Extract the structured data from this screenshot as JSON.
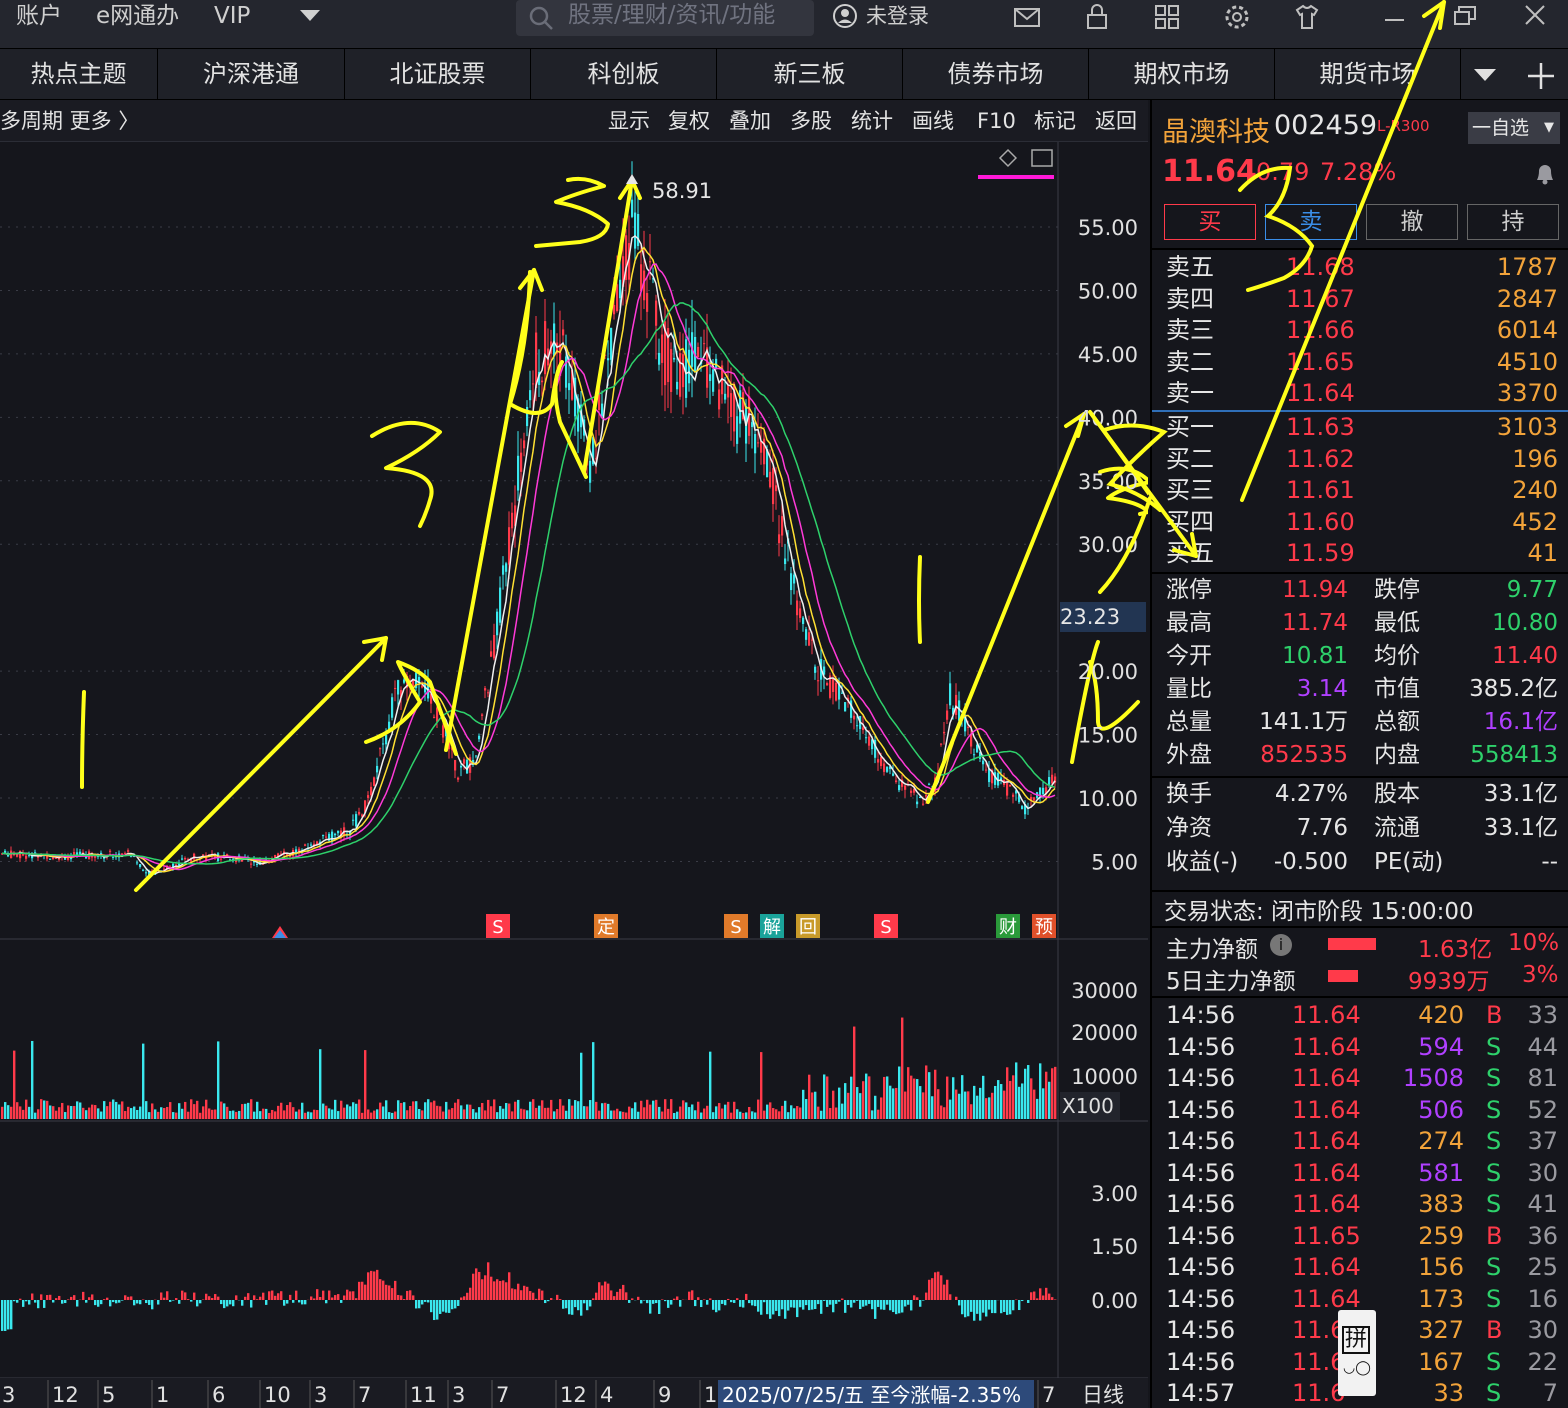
{
  "topbar": {
    "account": "账户",
    "egov": "e网通办",
    "vip": "VIP",
    "search_placeholder": "股票/理财/资讯/功能",
    "login": "未登录"
  },
  "nav": [
    "热点主题",
    "沪深港通",
    "北证股票",
    "科创板",
    "新三板",
    "债券市场",
    "期权市场",
    "期货市场"
  ],
  "chart_toolbar": {
    "left": "多周期  更多 〉",
    "items": [
      "显示",
      "复权",
      "叠加",
      "多股",
      "统计",
      "画线",
      "F10",
      "标记",
      "返回"
    ]
  },
  "chart_data": {
    "type": "candlestick",
    "price_axis": [
      "55.00",
      "50.00",
      "45.00",
      "40.00",
      "35.00",
      "30.00",
      "20.00",
      "15.00",
      "10.00",
      "5.00"
    ],
    "peak_label": "58.91",
    "current_marker": "23.23",
    "volume_axis": [
      "30000",
      "20000",
      "10000",
      "X100"
    ],
    "indicator_axis": [
      "3.00",
      "1.50",
      "0.00"
    ],
    "x_ticks": [
      "3",
      "12",
      "5",
      "1",
      "6",
      "10",
      "3",
      "7",
      "11",
      "3",
      "7",
      "12",
      "4",
      "9",
      "1",
      "7"
    ],
    "date_label": "2025/07/25/五  至今涨幅-2.35%",
    "period": "日线",
    "event_markers": [
      "S",
      "S",
      "定",
      "S",
      "解",
      "回",
      "S",
      "财",
      "预"
    ],
    "annotations": [
      "1",
      "3",
      "5",
      "3",
      "1",
      "2",
      "3"
    ]
  },
  "stock": {
    "name": "晶澳科技",
    "code": "002459",
    "tag": "L-R300",
    "watch_btn": "一自选",
    "price": "11.64",
    "change": "0.79",
    "pct": "7.28%",
    "buy": "买",
    "sell": "卖",
    "cancel": "撤",
    "hold": "持"
  },
  "orderbook": {
    "asks": [
      {
        "label": "卖五",
        "price": "11.68",
        "vol": "1787"
      },
      {
        "label": "卖四",
        "price": "11.67",
        "vol": "2847"
      },
      {
        "label": "卖三",
        "price": "11.66",
        "vol": "6014"
      },
      {
        "label": "卖二",
        "price": "11.65",
        "vol": "4510"
      },
      {
        "label": "卖一",
        "price": "11.64",
        "vol": "3370"
      }
    ],
    "bids": [
      {
        "label": "买一",
        "price": "11.63",
        "vol": "3103"
      },
      {
        "label": "买二",
        "price": "11.62",
        "vol": "196"
      },
      {
        "label": "买三",
        "price": "11.61",
        "vol": "240"
      },
      {
        "label": "买四",
        "price": "11.60",
        "vol": "452"
      },
      {
        "label": "买五",
        "price": "11.59",
        "vol": "41"
      }
    ]
  },
  "stats": [
    [
      {
        "k": "涨停",
        "v": "11.94",
        "c": "red"
      },
      {
        "k": "跌停",
        "v": "9.77",
        "c": "green"
      }
    ],
    [
      {
        "k": "最高",
        "v": "11.74",
        "c": "red"
      },
      {
        "k": "最低",
        "v": "10.80",
        "c": "green"
      }
    ],
    [
      {
        "k": "今开",
        "v": "10.81",
        "c": "green"
      },
      {
        "k": "均价",
        "v": "11.40",
        "c": "red"
      }
    ],
    [
      {
        "k": "量比",
        "v": "3.14",
        "c": "purple"
      },
      {
        "k": "市值",
        "v": "385.2亿",
        "c": "white"
      }
    ],
    [
      {
        "k": "总量",
        "v": "141.1万",
        "c": "white"
      },
      {
        "k": "总额",
        "v": "16.1亿",
        "c": "purple"
      }
    ],
    [
      {
        "k": "外盘",
        "v": "852535",
        "c": "red"
      },
      {
        "k": "内盘",
        "v": "558413",
        "c": "green"
      }
    ]
  ],
  "stats2": [
    [
      {
        "k": "换手",
        "v": "4.27%"
      },
      {
        "k": "股本",
        "v": "33.1亿"
      }
    ],
    [
      {
        "k": "净资",
        "v": "7.76"
      },
      {
        "k": "流通",
        "v": "33.1亿"
      }
    ],
    [
      {
        "k": "收益(-)",
        "v": "-0.500"
      },
      {
        "k": "PE(动)",
        "v": "--"
      }
    ]
  ],
  "trade_status": "交易状态: 闭市阶段 15:00:00",
  "main_flow": {
    "label": "主力净额",
    "value": "1.63亿",
    "pct": "10%"
  },
  "flow5": {
    "label": "5日主力净额",
    "value": "9939万",
    "pct": "3%"
  },
  "ticks": [
    {
      "t": "14:56",
      "p": "11.64",
      "v": "420",
      "vc": "orange",
      "s": "B",
      "n": "33"
    },
    {
      "t": "14:56",
      "p": "11.64",
      "v": "594",
      "vc": "purple",
      "s": "S",
      "n": "44"
    },
    {
      "t": "14:56",
      "p": "11.64",
      "v": "1508",
      "vc": "purple",
      "s": "S",
      "n": "81"
    },
    {
      "t": "14:56",
      "p": "11.64",
      "v": "506",
      "vc": "purple",
      "s": "S",
      "n": "52"
    },
    {
      "t": "14:56",
      "p": "11.64",
      "v": "274",
      "vc": "orange",
      "s": "S",
      "n": "37"
    },
    {
      "t": "14:56",
      "p": "11.64",
      "v": "581",
      "vc": "purple",
      "s": "S",
      "n": "30"
    },
    {
      "t": "14:56",
      "p": "11.64",
      "v": "383",
      "vc": "orange",
      "s": "S",
      "n": "41"
    },
    {
      "t": "14:56",
      "p": "11.65",
      "v": "259",
      "vc": "orange",
      "s": "B",
      "n": "36"
    },
    {
      "t": "14:56",
      "p": "11.64",
      "v": "156",
      "vc": "orange",
      "s": "S",
      "n": "25"
    },
    {
      "t": "14:56",
      "p": "11.64",
      "v": "173",
      "vc": "orange",
      "s": "S",
      "n": "16"
    },
    {
      "t": "14:56",
      "p": "11.6",
      "v": "327",
      "vc": "orange",
      "s": "B",
      "n": "30"
    },
    {
      "t": "14:56",
      "p": "11.6",
      "v": "167",
      "vc": "orange",
      "s": "S",
      "n": "22"
    },
    {
      "t": "14:57",
      "p": "11.6",
      "v": "33",
      "vc": "orange",
      "s": "S",
      "n": "7"
    }
  ],
  "pin_label": "拼"
}
